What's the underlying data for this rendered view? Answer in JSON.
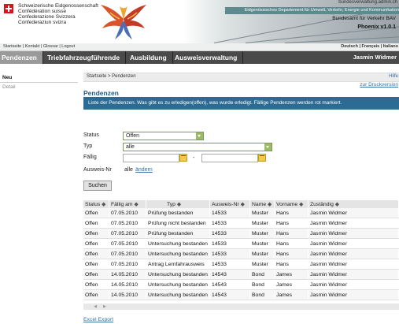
{
  "header": {
    "confederation_lines": [
      "Schweizerische Eidgenossenschaft",
      "Confédération suisse",
      "Confederazione Svizzera",
      "Confederaziun svizra"
    ],
    "top_url": "bundesverwaltung.admin.ch",
    "department": "Eidgenössisches Departement für Umwelt, Verkehr, Energie und Kommunikation",
    "office": "Bundesamt für Verkehr BAV",
    "app_name": "Phoenix v1.0.1"
  },
  "utility": {
    "links": "Startseite | Kontakt | Glossar | Logout",
    "languages": "Deutsch | Français | Italiano"
  },
  "nav": {
    "items": [
      "Pendenzen",
      "Triebfahrzeugführende",
      "Ausbildung",
      "Ausweisverwaltung"
    ],
    "user": "Jasmin Widmer"
  },
  "sidebar": {
    "items": [
      "Neu",
      "Detail"
    ]
  },
  "breadcrumb": {
    "text": "Startseite > Pendenzen",
    "help": "Hilfe"
  },
  "print_link": "zur Druckversion",
  "page_title": "Pendenzen",
  "info_text": "Liste der Pendenzen. Was gibt es zu erledigen(offen), was wurde erledigt. Fällige Pendenzen werden rot markiert.",
  "form": {
    "status_label": "Status",
    "status_value": "Offen",
    "typ_label": "Typ",
    "typ_value": "alle",
    "faellig_label": "Fällig",
    "date_separator": "-",
    "ausweis_label": "Ausweis-Nr",
    "ausweis_value": "alle",
    "ausweis_change": "ändern",
    "search_button": "Suchen"
  },
  "table": {
    "headers": [
      "Status",
      "Fällig am",
      "Typ",
      "Ausweis-Nr",
      "Name",
      "Vorname",
      "Zuständig"
    ],
    "rows": [
      [
        "Offen",
        "07.05.2010",
        "Prüfung bestanden",
        "14533",
        "Muster",
        "Hans",
        "Jasmin Widmer"
      ],
      [
        "Offen",
        "07.05.2010",
        "Prüfung nicht bestanden",
        "14533",
        "Muster",
        "Hans",
        "Jasmin Widmer"
      ],
      [
        "Offen",
        "07.05.2010",
        "Prüfung bestanden",
        "14533",
        "Muster",
        "Hans",
        "Jasmin Widmer"
      ],
      [
        "Offen",
        "07.05.2010",
        "Untersuchung bestanden",
        "14533",
        "Muster",
        "Hans",
        "Jasmin Widmer"
      ],
      [
        "Offen",
        "07.05.2010",
        "Untersuchung bestanden",
        "14533",
        "Muster",
        "Hans",
        "Jasmin Widmer"
      ],
      [
        "Offen",
        "07.05.2010",
        "Antrag Lernfahrausweis",
        "14533",
        "Muster",
        "Hans",
        "Jasmin Widmer"
      ],
      [
        "Offen",
        "14.05.2010",
        "Untersuchung bestanden",
        "14543",
        "Bond",
        "James",
        "Jasmin Widmer"
      ],
      [
        "Offen",
        "14.05.2010",
        "Untersuchung bestanden",
        "14543",
        "Bond",
        "James",
        "Jasmin Widmer"
      ],
      [
        "Offen",
        "14.05.2010",
        "Untersuchung bestanden",
        "14543",
        "Bond",
        "James",
        "Jasmin Widmer"
      ]
    ],
    "sort_icon": "diamond-sort-icon"
  },
  "excel_export": "Excel Export",
  "colors": {
    "nav_bg": "#4a4a4a",
    "info_bg": "#2b6b94",
    "title": "#1e5c84",
    "link": "#356fa5"
  }
}
